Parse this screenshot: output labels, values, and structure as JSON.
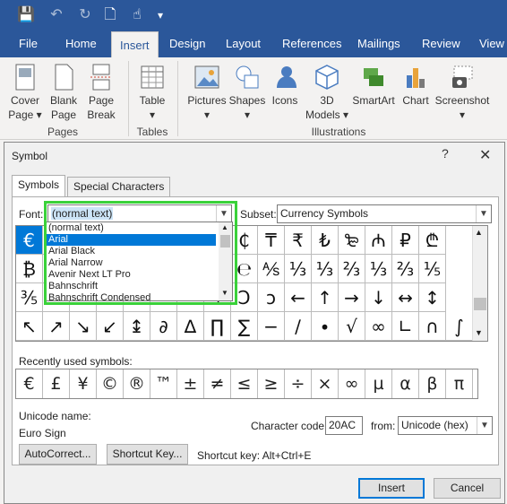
{
  "qat": {
    "save": "💾",
    "undo": "↶",
    "redo": "↻",
    "new": "🗋",
    "touch": "☝",
    "more": "▾"
  },
  "menu": [
    "File",
    "Home",
    "Insert",
    "Design",
    "Layout",
    "References",
    "Mailings",
    "Review",
    "View"
  ],
  "ribbon": {
    "cover_page": [
      "Cover",
      "Page ▾"
    ],
    "blank_page": [
      "Blank",
      "Page"
    ],
    "page_break": [
      "Page",
      "Break"
    ],
    "group_pages": "Pages",
    "table": [
      "Table",
      "▾"
    ],
    "group_tables": "Tables",
    "pictures": [
      "Pictures",
      "▾"
    ],
    "shapes": [
      "Shapes",
      "▾"
    ],
    "icons": "Icons",
    "models": [
      "3D",
      "Models ▾"
    ],
    "smartart": "SmartArt",
    "chart": "Chart",
    "screenshot": [
      "Screenshot",
      "▾"
    ],
    "group_illustrations": "Illustrations"
  },
  "dialog": {
    "title": "Symbol",
    "help": "?",
    "close": "✕",
    "tab_symbols": "Symbols",
    "tab_special": "Special Characters",
    "font_label": "Font:",
    "font_value": "(normal text)",
    "subset_label": "Subset:",
    "subset_value": "Currency Symbols",
    "font_list": [
      "(normal text)",
      "Arial",
      "Arial Black",
      "Arial Narrow",
      "Avenir Next LT Pro",
      "Bahnschrift",
      "Bahnschrift Condensed"
    ],
    "grid": [
      [
        "€",
        "",
        "",
        "",
        "",
        "",
        "",
        "₴",
        "₵",
        "₸",
        "₹",
        "₺",
        "₻",
        "₼",
        "₽",
        "₾"
      ],
      [
        "₿",
        "",
        "",
        "",
        "",
        "",
        "",
        "Ω",
        "℮",
        "⅍",
        "⅓",
        "⅓",
        "⅔",
        "⅓",
        "⅔",
        "⅕"
      ],
      [
        "⅗",
        "",
        "",
        "",
        "",
        "",
        "",
        "⅟",
        "Ↄ",
        "ↄ",
        "←",
        "↑",
        "→",
        "↓",
        "↔",
        "↕"
      ],
      [
        "↖",
        "↗",
        "↘",
        "↙",
        "↨",
        "∂",
        "∆",
        "∏",
        "∑",
        "−",
        "∕",
        "∙",
        "√",
        "∞",
        "∟",
        "∩",
        "∫"
      ]
    ],
    "recent_label": "Recently used symbols:",
    "recent": [
      "€",
      "£",
      "¥",
      "©",
      "®",
      "™",
      "±",
      "≠",
      "≤",
      "≥",
      "÷",
      "×",
      "∞",
      "µ",
      "α",
      "β",
      "π"
    ],
    "unicode_name_label": "Unicode name:",
    "unicode_name": "Euro Sign",
    "char_code_label": "Character code:",
    "char_code": "20AC",
    "from_label": "from:",
    "from_value": "Unicode (hex)",
    "autocorrect": "AutoCorrect...",
    "shortcut_key_btn": "Shortcut Key...",
    "shortcut_key_text": "Shortcut key: Alt+Ctrl+E",
    "insert": "Insert",
    "cancel": "Cancel"
  }
}
